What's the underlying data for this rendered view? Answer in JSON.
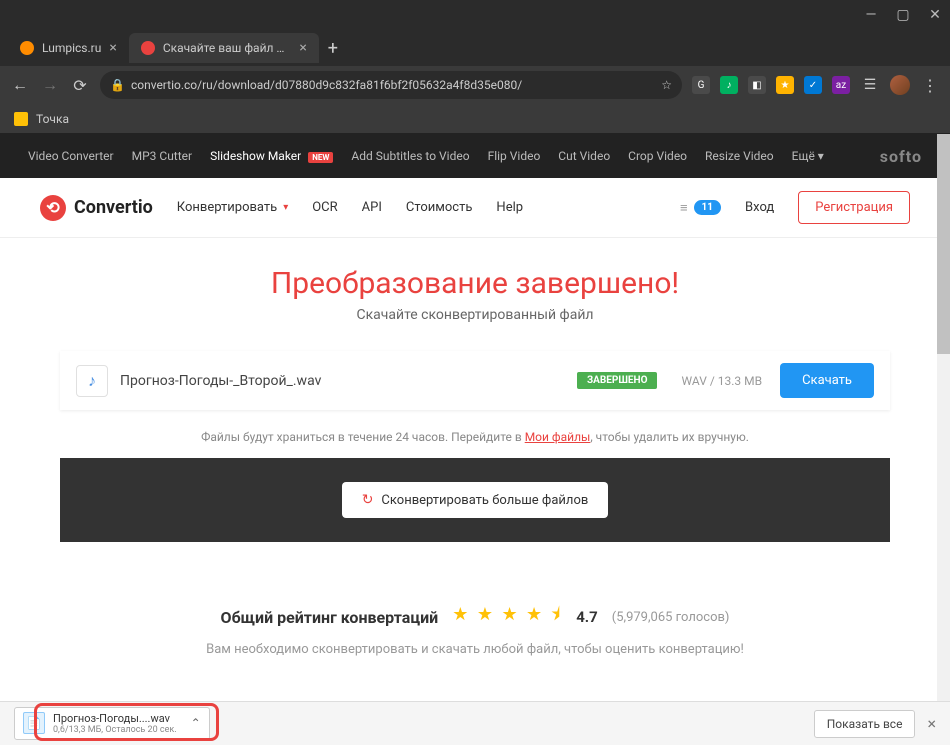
{
  "window": {
    "minimize": "—",
    "maximize": "▢",
    "close": "✕"
  },
  "tabs": [
    {
      "title": "Lumpics.ru",
      "active": false
    },
    {
      "title": "Скачайте ваш файл — Convertio",
      "active": true
    }
  ],
  "url": "convertio.co/ru/download/d07880d9c832fa81f6bf2f05632a4f8d35e080/",
  "bookmark": "Точка",
  "topnav": {
    "items": [
      "Video Converter",
      "MP3 Cutter",
      "Slideshow Maker",
      "Add Subtitles to Video",
      "Flip Video",
      "Cut Video",
      "Crop Video",
      "Resize Video",
      "Ещё"
    ],
    "new": "NEW",
    "brand": "softo"
  },
  "mainnav": {
    "logo": "Convertio",
    "convert": "Конвертировать",
    "ocr": "OCR",
    "api": "API",
    "price": "Стоимость",
    "help": "Help",
    "conversions": "11",
    "login": "Вход",
    "register": "Регистрация"
  },
  "hero": {
    "title": "Преобразование завершено!",
    "subtitle": "Скачайте сконвертированный файл"
  },
  "file": {
    "name": "Прогноз-Погоды-_Второй_.wav",
    "status": "ЗАВЕРШЕНО",
    "info": "WAV / 13.3 MB",
    "download": "Скачать"
  },
  "storage": {
    "pre": "Файлы будут храниться в течение 24 часов. Перейдите в ",
    "link": "Мои файлы",
    "post": ", чтобы удалить их вручную."
  },
  "more": "Сконвертировать больше файлов",
  "rating": {
    "label": "Общий рейтинг конвертаций",
    "stars": "★ ★ ★ ★ ⯨",
    "score": "4.7",
    "count": "(5,979,065 голосов)",
    "note": "Вам необходимо сконвертировать и скачать любой файл, чтобы оценить конвертацию!"
  },
  "shelf": {
    "filename": "Прогноз-Погоды....wav",
    "progress": "0,6/13,3 МБ, Осталось 20 сек.",
    "showall": "Показать все"
  }
}
